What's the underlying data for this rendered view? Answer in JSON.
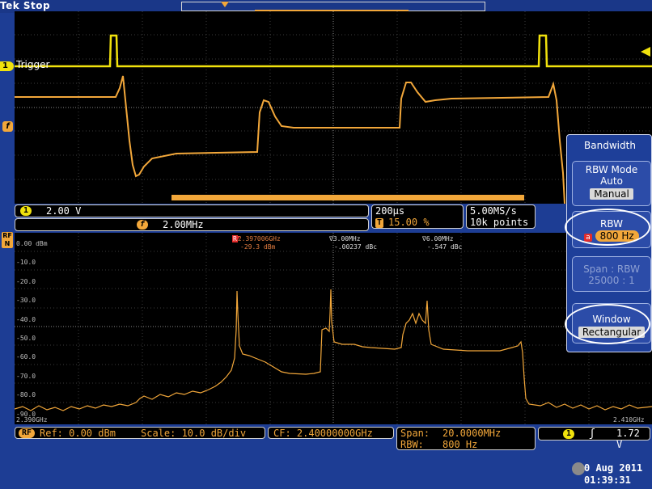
{
  "status": {
    "acq_state": "Tek Stop",
    "trigger_marker": "T"
  },
  "time_domain": {
    "channel_label": "1",
    "trigger_label": "Trigger",
    "math_marker": "f",
    "ch1_scale_chip": "1",
    "ch1_scale": "2.00 V",
    "math_chip": "f",
    "math_scale": "2.00MHz",
    "timebase": "200µs",
    "trigger_pos_chip": "T",
    "trigger_pos": "15.00 %",
    "sample_rate": "5.00MS/s",
    "record_length": "10k points"
  },
  "freq_domain": {
    "rf_tag": "RF",
    "rf_sub": "N",
    "ref_levels": [
      "0.00 dBm",
      "-10.0",
      "-20.0",
      "-30.0",
      "-40.0",
      "-50.0",
      "-60.0",
      "-70.0",
      "-80.0",
      "-90.0"
    ],
    "start_freq": "2.390GHz",
    "stop_freq": "2.410GHz",
    "marker_r": {
      "tag": "R",
      "freq": "2.397006GHz",
      "level": "-29.3 dBm"
    },
    "marker_1": {
      "tag": "∇",
      "freq": "3.00MHz",
      "level": "-.00237 dBc"
    },
    "marker_2": {
      "tag": "∇",
      "freq": "6.00MHz",
      "level": "-.547 dBc"
    },
    "ref_chip": "RF",
    "ref": "Ref: 0.00 dBm",
    "scale": "Scale: 10.0 dB/div",
    "cf": "CF: 2.40000000GHz",
    "span_label": "Span:",
    "span": "20.0000MHz",
    "rbw_label": "RBW:",
    "rbw": "800 Hz",
    "trig_chip": "1",
    "trig_slope": "ʃ",
    "trig_level": "1.72 V"
  },
  "menu": {
    "title": "Bandwidth",
    "rbw_mode": {
      "label": "RBW Mode",
      "option_auto": "Auto",
      "option_manual": "Manual"
    },
    "rbw": {
      "label": "RBW",
      "chip": "a",
      "value": "800 Hz"
    },
    "span_rbw": {
      "label": "Span : RBW",
      "value": "25000 : 1"
    },
    "window": {
      "label": "Window",
      "value": "Rectangular"
    }
  },
  "datetime": {
    "date": "0 Aug 2011",
    "time": "01:39:31"
  },
  "colors": {
    "ch1": "#f1e20d",
    "math": "#f2a73a",
    "background": "#1d3d94"
  }
}
